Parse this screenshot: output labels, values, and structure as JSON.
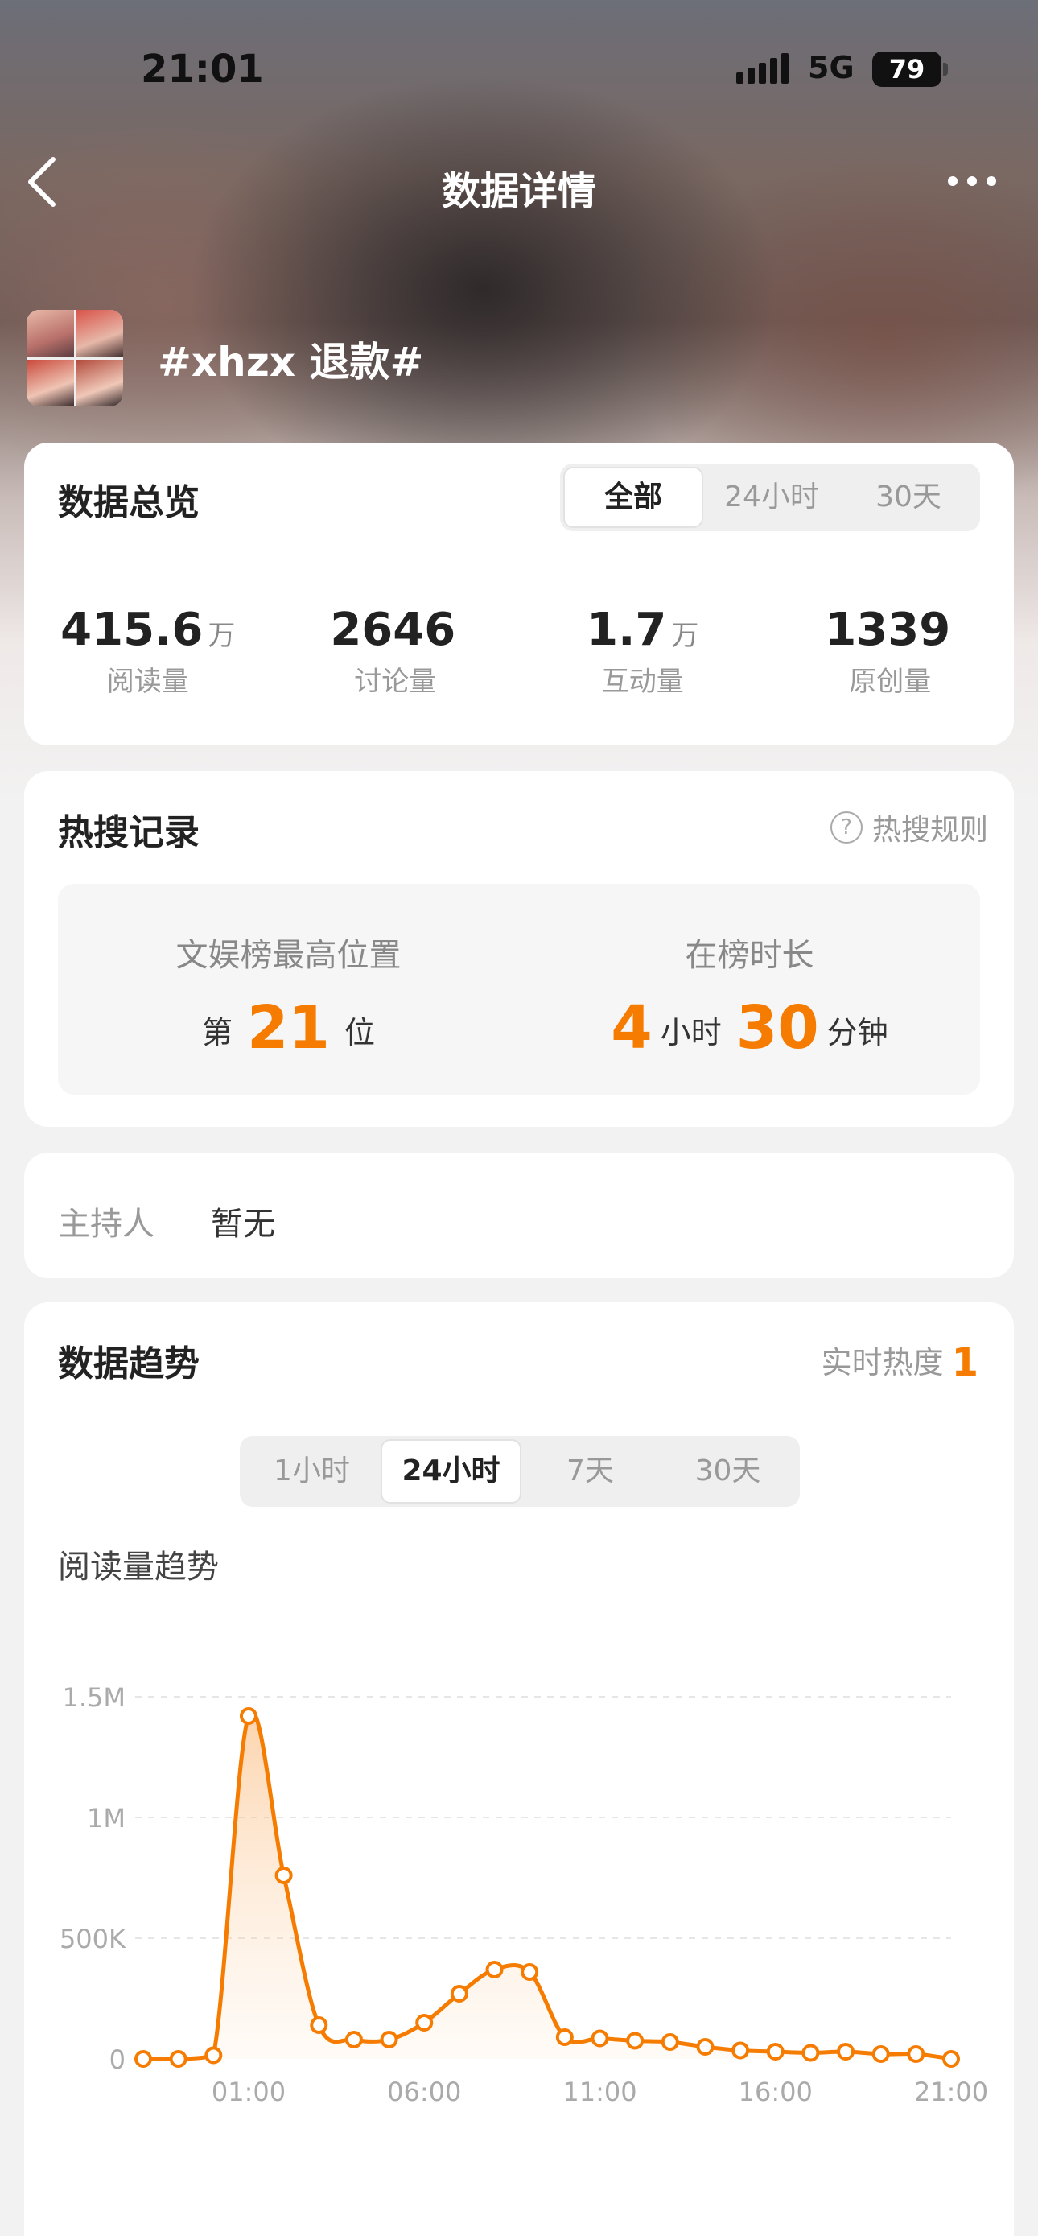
{
  "status_bar": {
    "time": "21:01",
    "network": "5G",
    "battery": "79"
  },
  "nav": {
    "title": "数据详情"
  },
  "topic": {
    "title": "#xhzx 退款#"
  },
  "overview": {
    "title": "数据总览",
    "tabs": [
      {
        "label": "全部",
        "active": true
      },
      {
        "label": "24小时",
        "active": false
      },
      {
        "label": "30天",
        "active": false
      }
    ],
    "stats": [
      {
        "value": "415.6",
        "unit": "万",
        "label": "阅读量"
      },
      {
        "value": "2646",
        "unit": "",
        "label": "讨论量"
      },
      {
        "value": "1.7",
        "unit": "万",
        "label": "互动量"
      },
      {
        "value": "1339",
        "unit": "",
        "label": "原创量"
      }
    ]
  },
  "hot_search": {
    "title": "热搜记录",
    "rules_label": "热搜规则",
    "rank_label": "文娱榜最高位置",
    "rank_prefix": "第",
    "rank_value": "21",
    "rank_suffix": "位",
    "duration_label": "在榜时长",
    "hours_value": "4",
    "hours_unit": "小时",
    "minutes_value": "30",
    "minutes_unit": "分钟"
  },
  "host": {
    "label": "主持人",
    "value": "暂无"
  },
  "trend": {
    "title": "数据趋势",
    "heat_label": "实时热度",
    "heat_value": "1",
    "tabs": [
      {
        "label": "1小时",
        "active": false
      },
      {
        "label": "24小时",
        "active": true
      },
      {
        "label": "7天",
        "active": false
      },
      {
        "label": "30天",
        "active": false
      }
    ],
    "chart_title": "阅读量趋势"
  },
  "colors": {
    "accent": "#f57c00"
  },
  "chart_data": {
    "type": "area",
    "title": "阅读量趋势",
    "xlabel": "",
    "ylabel": "",
    "x_tick_labels": [
      "01:00",
      "06:00",
      "11:00",
      "16:00",
      "21:00"
    ],
    "y_tick_labels": [
      "0",
      "500K",
      "1M",
      "1.5M"
    ],
    "y_ticks": [
      0,
      500000,
      1000000,
      1500000
    ],
    "ylim": [
      0,
      1500000
    ],
    "x_hours": [
      -2,
      -1,
      0,
      1,
      2,
      3,
      4,
      5,
      6,
      7,
      8,
      9,
      10,
      11,
      12,
      13,
      14,
      15,
      16,
      17,
      18,
      19,
      20,
      21
    ],
    "series": [
      {
        "values": [
          0,
          0,
          15000,
          1420000,
          760000,
          140000,
          80000,
          80000,
          150000,
          270000,
          370000,
          360000,
          90000,
          85000,
          75000,
          70000,
          50000,
          35000,
          30000,
          25000,
          30000,
          20000,
          20000,
          0
        ]
      }
    ],
    "grid": true,
    "legend": "none"
  }
}
